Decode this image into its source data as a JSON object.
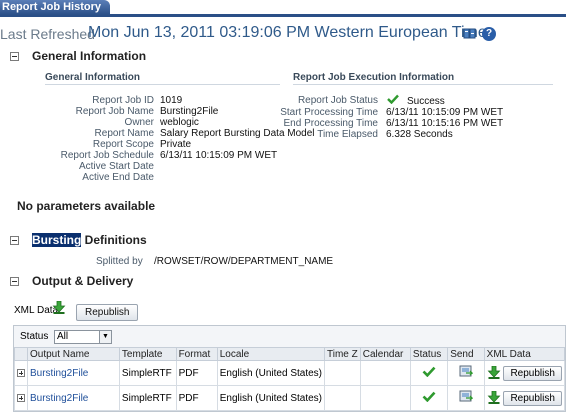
{
  "tab": {
    "label": "Report Job History"
  },
  "refresh": {
    "label": "Last Refreshed",
    "value": "Mon Jun 13, 2011 03:19:06 PM Western European Time"
  },
  "general": {
    "section_title": "General Information",
    "left_header": "General Information",
    "right_header": "Report Job Execution Information",
    "fields": [
      {
        "label": "Report Job ID",
        "value": "1019"
      },
      {
        "label": "Report Job Name",
        "value": "Bursting2File"
      },
      {
        "label": "Owner",
        "value": "weblogic"
      },
      {
        "label": "Report Name",
        "value": "Salary Report Bursting Data Model"
      },
      {
        "label": "Report Scope",
        "value": "Private"
      },
      {
        "label": "Report Job Schedule",
        "value": "6/13/11 10:15:09 PM WET"
      },
      {
        "label": "Active Start Date",
        "value": ""
      },
      {
        "label": "Active End Date",
        "value": ""
      }
    ],
    "exec_fields": [
      {
        "label": "Report Job Status",
        "value": "Success"
      },
      {
        "label": "Start Processing Time",
        "value": "6/13/11 10:15:09 PM WET"
      },
      {
        "label": "End Processing Time",
        "value": "6/13/11 10:15:16 PM WET"
      },
      {
        "label": "Time Elapsed",
        "value": "6.328 Seconds"
      }
    ]
  },
  "params": {
    "text": "No parameters available"
  },
  "bursting": {
    "title_highlight": "Bursting",
    "title_rest": " Definitions",
    "label": "Splitted by",
    "value": "/ROWSET/ROW/DEPARTMENT_NAME"
  },
  "output": {
    "section_title": "Output & Delivery",
    "xml_label": "XML Data",
    "republish_label": "Republish",
    "status_label": "Status",
    "status_selected": "All",
    "columns": [
      "Output Name",
      "Template",
      "Format",
      "Locale",
      "Time Z",
      "Calendar",
      "Status",
      "Send",
      "XML Data"
    ],
    "rows": [
      {
        "name": "Bursting2File",
        "template": "SimpleRTF",
        "format": "PDF",
        "locale": "English (United States)",
        "button": "Republish"
      },
      {
        "name": "Bursting2File",
        "template": "SimpleRTF",
        "format": "PDF",
        "locale": "English (United States)",
        "button": "Republish"
      }
    ]
  },
  "colors": {
    "link": "#1f4f9a",
    "tab": "#2a4f87",
    "success": "#2f9a2f",
    "download": "#2f9a2f"
  }
}
